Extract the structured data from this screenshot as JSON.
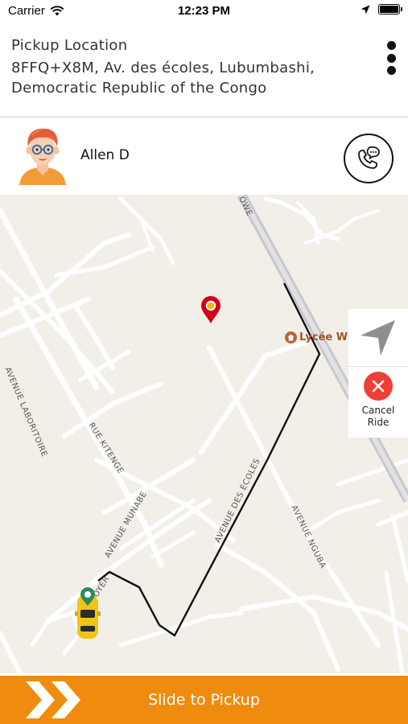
{
  "status_bar": {
    "carrier": "Carrier",
    "time": "12:23 PM",
    "icons": [
      "wifi-icon",
      "location-arrow-icon",
      "battery-icon"
    ]
  },
  "pickup": {
    "title": "Pickup Location",
    "address": "8FFQ+X8M, Av. des écoles, Lubumbashi, Democratic Republic of the Congo",
    "menu_icon": "more-vertical-icon"
  },
  "driver": {
    "name": "Allen D",
    "avatar_icon": "driver-avatar",
    "call_icon": "phone-chat-icon"
  },
  "map": {
    "street_labels": [
      "AVENUE LABORITOIRE",
      "RUE KITENGE",
      "AVENUE MUNABE",
      "AVENUE DES ÉCOLES",
      "AVENUE NGUBA",
      "OWE",
      "OYER"
    ],
    "poi_label": "Lycée WE",
    "pickup_marker": "pickup-pin-icon",
    "vehicle": "taxi-car-icon"
  },
  "actions": {
    "recenter_icon": "navigation-arrow-icon",
    "cancel_label": "Cancel Ride",
    "cancel_icon": "close-icon"
  },
  "slider": {
    "label": "Slide to Pickup",
    "handle_icon": "double-chevron-right-icon"
  },
  "colors": {
    "accent": "#ef8c0f",
    "cancel": "#ee3e36",
    "map_background": "#f2efe9",
    "route": "#111111",
    "marker": "#d0021b"
  }
}
